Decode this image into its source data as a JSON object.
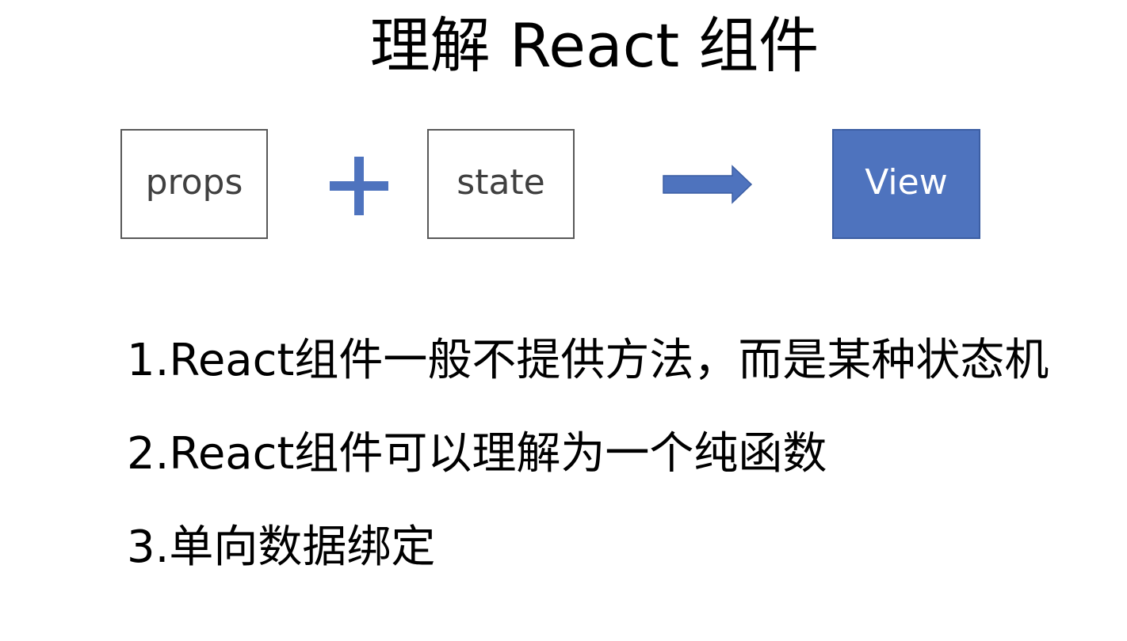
{
  "slide": {
    "title": "理解 React 组件"
  },
  "diagram": {
    "props_label": "props",
    "state_label": "state",
    "view_label": "View",
    "plus_icon": "plus-icon",
    "arrow_icon": "right-arrow-icon",
    "colors": {
      "accent": "#4e73be",
      "box_border": "#595959",
      "box_text": "#404040",
      "view_text": "#ffffff"
    }
  },
  "points": [
    "1.React组件一般不提供方法，而是某种状态机",
    "2.React组件可以理解为一个纯函数",
    "3.单向数据绑定"
  ]
}
